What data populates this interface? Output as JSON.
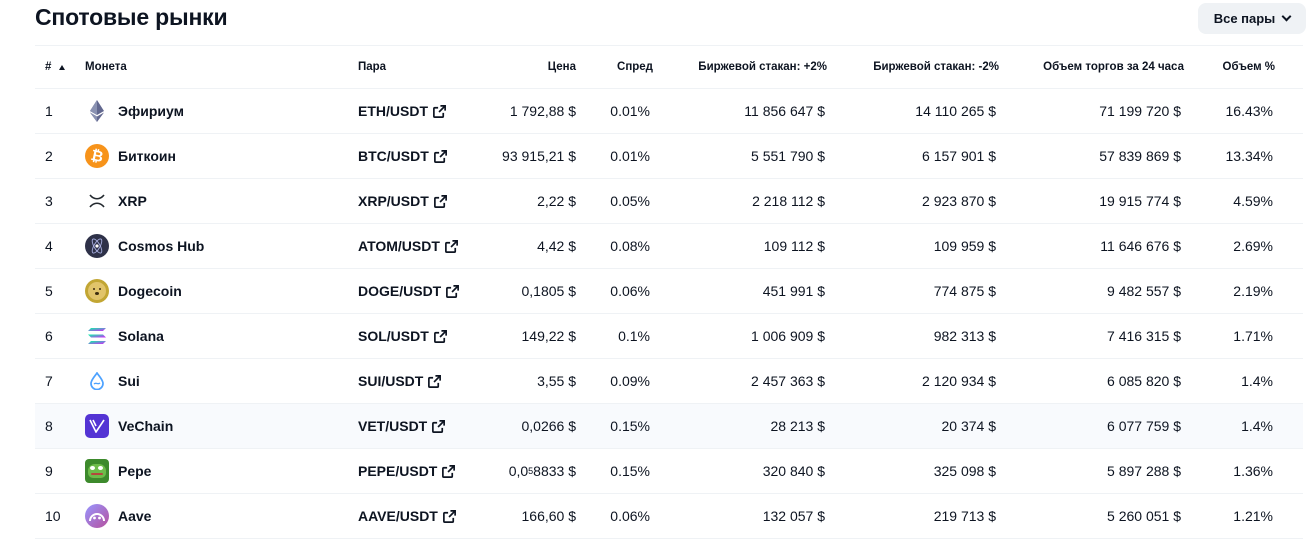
{
  "header": {
    "title": "Спотовые рынки",
    "filter_label": "Все пары"
  },
  "columns": {
    "num": "#",
    "coin": "Монета",
    "pair": "Пара",
    "price": "Цена",
    "spread": "Спред",
    "depth_plus": "Биржевой стакан: +2%",
    "depth_minus": "Биржевой стакан: -2%",
    "volume": "Объем торгов за 24 часа",
    "volume_pct": "Объем %"
  },
  "rows": [
    {
      "num": "1",
      "coin": "Эфириум",
      "icon": "ethereum-icon",
      "pair": "ETH/USDT",
      "price": "1 792,88 $",
      "spread": "0.01%",
      "depth_plus": "11 856 647 $",
      "depth_minus": "14 110 265 $",
      "volume": "71 199 720 $",
      "volume_pct": "16.43%"
    },
    {
      "num": "2",
      "coin": "Биткоин",
      "icon": "bitcoin-icon",
      "pair": "BTC/USDT",
      "price": "93 915,21 $",
      "spread": "0.01%",
      "depth_plus": "5 551 790 $",
      "depth_minus": "6 157 901 $",
      "volume": "57 839 869 $",
      "volume_pct": "13.34%"
    },
    {
      "num": "3",
      "coin": "XRP",
      "icon": "xrp-icon",
      "pair": "XRP/USDT",
      "price": "2,22 $",
      "spread": "0.05%",
      "depth_plus": "2 218 112 $",
      "depth_minus": "2 923 870 $",
      "volume": "19 915 774 $",
      "volume_pct": "4.59%"
    },
    {
      "num": "4",
      "coin": "Cosmos Hub",
      "icon": "cosmos-icon",
      "pair": "ATOM/USDT",
      "price": "4,42 $",
      "spread": "0.08%",
      "depth_plus": "109 112 $",
      "depth_minus": "109 959 $",
      "volume": "11 646 676 $",
      "volume_pct": "2.69%"
    },
    {
      "num": "5",
      "coin": "Dogecoin",
      "icon": "dogecoin-icon",
      "pair": "DOGE/USDT",
      "price": "0,1805 $",
      "spread": "0.06%",
      "depth_plus": "451 991 $",
      "depth_minus": "774 875 $",
      "volume": "9 482 557 $",
      "volume_pct": "2.19%"
    },
    {
      "num": "6",
      "coin": "Solana",
      "icon": "solana-icon",
      "pair": "SOL/USDT",
      "price": "149,22 $",
      "spread": "0.1%",
      "depth_plus": "1 006 909 $",
      "depth_minus": "982 313 $",
      "volume": "7 416 315 $",
      "volume_pct": "1.71%"
    },
    {
      "num": "7",
      "coin": "Sui",
      "icon": "sui-icon",
      "pair": "SUI/USDT",
      "price": "3,55 $",
      "spread": "0.09%",
      "depth_plus": "2 457 363 $",
      "depth_minus": "2 120 934 $",
      "volume": "6 085 820 $",
      "volume_pct": "1.4%"
    },
    {
      "num": "8",
      "coin": "VeChain",
      "icon": "vechain-icon",
      "pair": "VET/USDT",
      "price": "0,0266 $",
      "spread": "0.15%",
      "depth_plus": "28 213 $",
      "depth_minus": "20 374 $",
      "volume": "6 077 759 $",
      "volume_pct": "1.4%"
    },
    {
      "num": "9",
      "coin": "Pepe",
      "icon": "pepe-icon",
      "pair": "PEPE/USDT",
      "price_main": "0,0",
      "price_sub": "5",
      "price_rest": "8833 $",
      "spread": "0.15%",
      "depth_plus": "320 840 $",
      "depth_minus": "325 098 $",
      "volume": "5 897 288 $",
      "volume_pct": "1.36%"
    },
    {
      "num": "10",
      "coin": "Aave",
      "icon": "aave-icon",
      "pair": "AAVE/USDT",
      "price": "166,60 $",
      "spread": "0.06%",
      "depth_plus": "132 057 $",
      "depth_minus": "219 713 $",
      "volume": "5 260 051 $",
      "volume_pct": "1.21%"
    }
  ],
  "highlighted_row": 8
}
